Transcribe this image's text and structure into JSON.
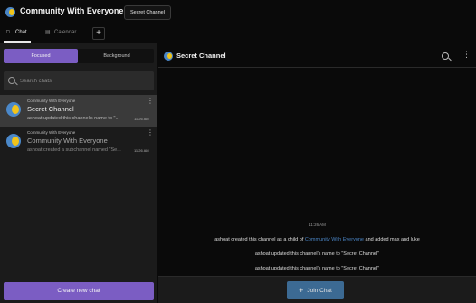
{
  "topbar": {
    "community_name": "Community With Everyone",
    "breadcrumb_chevron": "›",
    "current_channel": "Secret Channel"
  },
  "tabs": {
    "items": [
      {
        "label": "Chat",
        "icon": "chat-bubble-icon",
        "active": true
      },
      {
        "label": "Calendar",
        "icon": "calendar-icon",
        "active": false
      }
    ],
    "add_label": "+"
  },
  "left_panel": {
    "segments": [
      {
        "label": "Focused",
        "active": true
      },
      {
        "label": "Background",
        "active": false
      }
    ],
    "search": {
      "placeholder": "Search chats",
      "value": ""
    },
    "threads": [
      {
        "community": "Community With Everyone",
        "name": "Secret Channel",
        "preview": "ashoat updated this channel's name to \"...",
        "time": "11:26 AM",
        "selected": true
      },
      {
        "community": "Community With Everyone",
        "name": "Community With Everyone",
        "preview": "ashoat created a subchannel named \"Se...",
        "time": "11:26 AM",
        "selected": false
      }
    ],
    "create_button_label": "Create new chat"
  },
  "chat": {
    "title": "Secret Channel",
    "timestamp": "11:26 AM",
    "messages": [
      {
        "before_link": "ashoat created this channel as a child of ",
        "link": "Community With Everyone",
        "after_link": " and added max and luke"
      },
      {
        "text": "ashoat updated this channel's name to \"Secret Channel\""
      },
      {
        "text": "ashoat updated this channel's name to \"Secret Channel\""
      }
    ],
    "join_button_label": "Join Chat",
    "join_icon": "+"
  },
  "colors": {
    "accent_purple": "#7b5dc3",
    "join_blue": "#3c6a93",
    "link_blue": "#4a84c4",
    "background": "#0a0a0a",
    "panel": "#1b1b1b"
  }
}
